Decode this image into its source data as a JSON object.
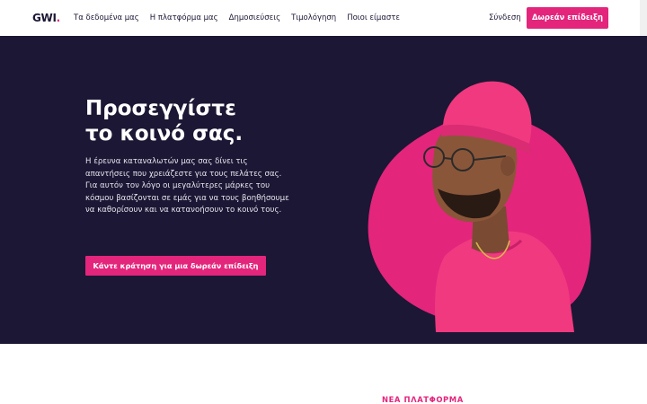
{
  "brand": {
    "logo_text": "GWI",
    "logo_dot": ".",
    "accent_color": "#e3257c",
    "dark_color": "#1b1734"
  },
  "nav": {
    "links": [
      "Τα δεδομένα μας",
      "Η πλατφόρμα μας",
      "Δημοσιεύσεις",
      "Τιμολόγηση",
      "Ποιοι είμαστε"
    ],
    "login": "Σύνδεση",
    "cta": "Δωρεάν επίδειξη"
  },
  "hero": {
    "headline_line1": "Προσεγγίστε",
    "headline_line2": "το κοινό σας.",
    "paragraph": "Η έρευνα καταναλωτών μας σας δίνει τις απαντήσεις που χρειάζεστε για τους πελάτες σας. Για αυτόν τον λόγο οι μεγαλύτερες μάρκες του κόσμου βασίζονται σε εμάς για να τους βοηθήσουμε να καθορίσουν και να κατανοήσουν το κοινό τους.",
    "cta": "Κάντε κράτηση για μια δωρεάν επίδειξη"
  },
  "lower": {
    "kicker": "ΝΕΑ ΠΛΑΤΦΟΡΜΑ"
  }
}
